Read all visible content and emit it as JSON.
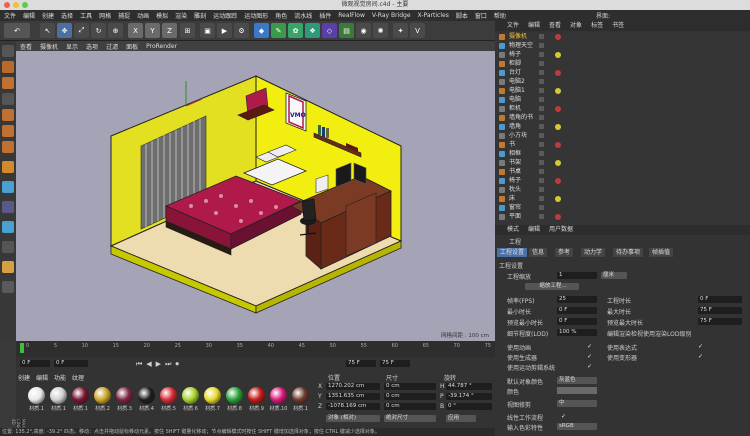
{
  "window": {
    "title": "微观视觉房间.c4d - 主要"
  },
  "menu": [
    "文件",
    "编辑",
    "创建",
    "选择",
    "工具",
    "网格",
    "捕捉",
    "动画",
    "模拟",
    "渲染",
    "雕刻",
    "运动跟踪",
    "运动图形",
    "角色",
    "流水线",
    "插件",
    "RealFlow",
    "V-Ray Bridge",
    "X-Particles",
    "脚本",
    "窗口",
    "帮助"
  ],
  "layout": {
    "label": "界面:",
    "value": "启动"
  },
  "viewport": {
    "menu": [
      "查看",
      "摄像机",
      "显示",
      "选项",
      "过滤",
      "面板",
      "ProRender"
    ],
    "grid_info": "网格间距 : 100 cm",
    "poster": "VMO"
  },
  "objmgr": {
    "tabs": [
      "文件",
      "编辑",
      "查看",
      "对象",
      "标签",
      "书签"
    ],
    "items": [
      "摄像机",
      "物理天空",
      "椅子",
      "柜脚",
      "台灯",
      "电脑2",
      "电脑1",
      "电脑",
      "柜机",
      "墙角的书",
      "墙角",
      "小方块",
      "书",
      "相框",
      "书架",
      "书桌",
      "椅子",
      "枕头",
      "床",
      "窗帘",
      "平面"
    ]
  },
  "attr": {
    "menu": [
      "模式",
      "编辑",
      "用户数据"
    ],
    "header": "工程",
    "tabs": [
      "工程设置",
      "信息",
      "参考",
      "动力学",
      "待办事项",
      "帧插值"
    ],
    "section": "工程设置",
    "scale_label": "工程缩放",
    "scale_value": "1",
    "scale_unit": "厘米",
    "scale_button": "缩放工程...",
    "fps_label": "帧率(FPS)",
    "fps_value": "25",
    "mintime_label": "最小时长",
    "mintime_value": "0 F",
    "prevmin_label": "预览最小时长",
    "prevmin_value": "0 F",
    "lod_label": "细节程度(LOD)",
    "lod_value": "100 %",
    "time_label": "工程时长",
    "time_value": "0 F",
    "maxtime_label": "最大时长",
    "maxtime_value": "75 F",
    "prevmax_label": "预览最大时长",
    "prevmax_value": "75 F",
    "editlod_label": "编辑渲染检视使用渲染LOD级别",
    "anim_label": "使用动画",
    "expr_label": "使用表达式",
    "gen_label": "使用生成器",
    "deform_label": "使用变形器",
    "motion_label": "使用运动剪辑系统",
    "color_label": "默认对象颜色",
    "color_value": "灰蓝色",
    "color2_label": "颜色",
    "clip_label": "视图修剪",
    "clip_value": "中",
    "lin_label": "线性工作流程",
    "input_label": "输入色彩特性",
    "input_value": "sRGB"
  },
  "timeline": {
    "ticks": [
      "0",
      "5",
      "10",
      "15",
      "20",
      "25",
      "30",
      "35",
      "40",
      "45",
      "50",
      "55",
      "60",
      "65",
      "70",
      "75"
    ],
    "frame": "0 F",
    "start": "0 F",
    "end": "75 F",
    "end2": "75 F"
  },
  "materials": {
    "menu": [
      "创建",
      "编辑",
      "功能",
      "纹理"
    ],
    "items": [
      {
        "name": "材质.1",
        "color": "#e8e8e8"
      },
      {
        "name": "材质.1",
        "color": "#d0d0d0"
      },
      {
        "name": "材质.1",
        "color": "#7a1530"
      },
      {
        "name": "材质.2",
        "color": "#caa52a"
      },
      {
        "name": "材质.3",
        "color": "#7e2445"
      },
      {
        "name": "材质.4",
        "color": "#1e1e1e"
      },
      {
        "name": "材质.5",
        "color": "#d72a36"
      },
      {
        "name": "材质.6",
        "color": "#a7d22b"
      },
      {
        "name": "材质.7",
        "color": "#e8d82b"
      },
      {
        "name": "材质.8",
        "color": "#27a33a"
      },
      {
        "name": "材质.9",
        "color": "#c81818"
      },
      {
        "name": "材质.10",
        "color": "#d81878"
      },
      {
        "name": "材质.1",
        "color": "#6c3a2a"
      }
    ]
  },
  "coords": {
    "headers": [
      "位置",
      "尺寸",
      "旋转"
    ],
    "x": "1270.202 cm",
    "y": "1351.635 cm",
    "z": "-1078.169 cm",
    "sx": "0 cm",
    "sy": "0 cm",
    "sz": "0 cm",
    "h": "44.787 °",
    "p": "-39.174 °",
    "b": "0 °",
    "mode1": "对象 (相对)",
    "mode2": "绝对尺寸",
    "apply": "应用"
  },
  "status": "位置: 135.2°,高度: -39.2° 匹态。移动：点击并拖动鼠标移动元素。按住 SHIFT 键量化移动；节点编辑模式时按住 SHIFT 键增加选择对象；按住 CTRL 键减少选择对象。",
  "brand": "MAXON CINEMA 4D"
}
